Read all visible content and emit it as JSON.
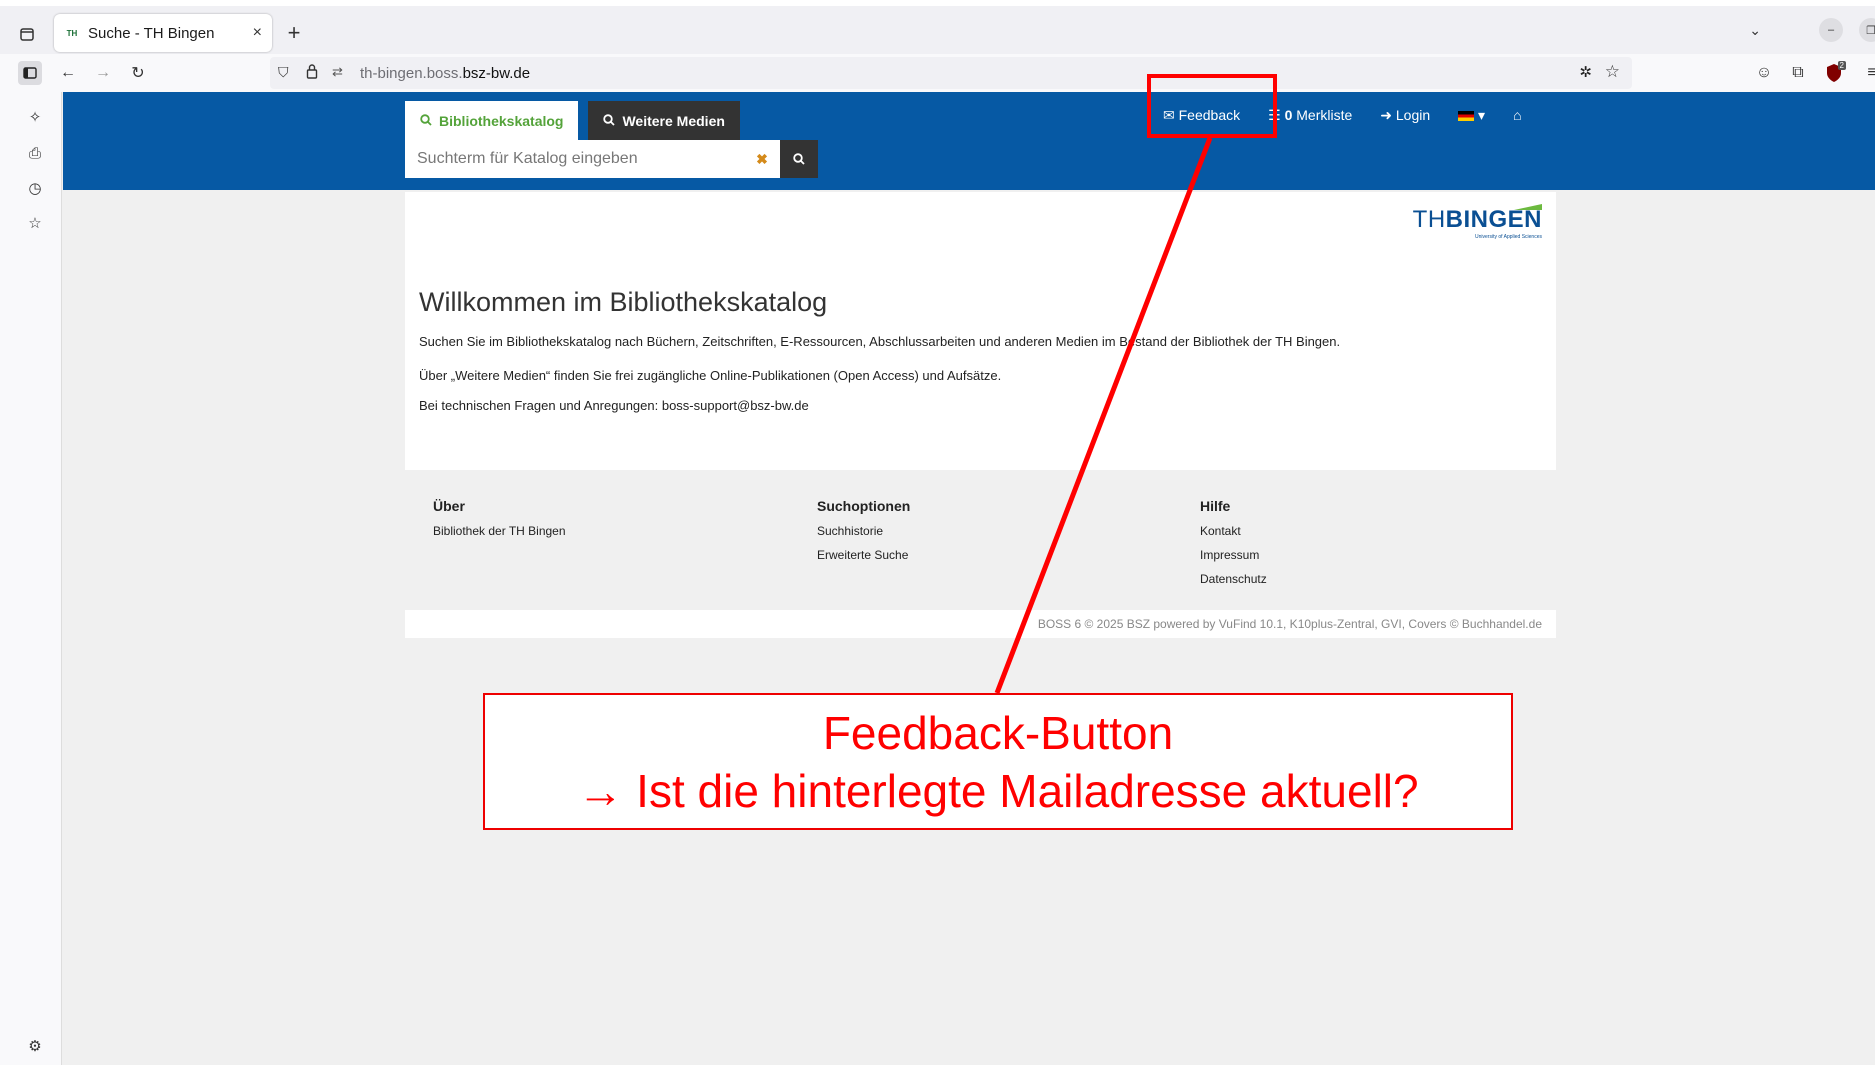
{
  "browser": {
    "tab": {
      "favicon": "TH",
      "title": "Suche - TH Bingen",
      "close": "×"
    },
    "new_tab": "+",
    "url_host_prefix": "th-bingen.boss.",
    "url_host_domain": "bsz-bw.de",
    "extension_badge": "2"
  },
  "header": {
    "tabs": [
      {
        "label": "Bibliothekskatalog",
        "icon": "search-icon"
      },
      {
        "label": "Weitere Medien",
        "icon": "search-icon"
      }
    ],
    "search_placeholder": "Suchterm für Katalog eingeben",
    "clear_glyph": "✖",
    "links": {
      "feedback": "Feedback",
      "merkliste_count": "0",
      "merkliste": "Merkliste",
      "login": "Login"
    }
  },
  "logo": {
    "th": "TH",
    "bingen": "BINGEN",
    "sub": "University of Applied Sciences"
  },
  "content": {
    "title": "Willkommen im Bibliothekskatalog",
    "p1": "Suchen Sie im Bibliothekskatalog nach Büchern, Zeitschriften, E-Ressourcen, Abschlussarbeiten und anderen Medien im Bestand der Bibliothek der TH Bingen.",
    "p2": "Über „Weitere Medien“ finden Sie frei zugängliche Online-Publikationen (Open Access) und Aufsätze.",
    "p3": "Bei technischen Fragen und Anregungen: boss-support@bsz-bw.de"
  },
  "footer": {
    "cols": [
      {
        "title": "Über",
        "links": [
          "Bibliothek der TH Bingen"
        ]
      },
      {
        "title": "Suchoptionen",
        "links": [
          "Suchhistorie",
          "Erweiterte Suche"
        ]
      },
      {
        "title": "Hilfe",
        "links": [
          "Kontakt",
          "Impressum",
          "Datenschutz"
        ]
      }
    ],
    "copyright": "BOSS 6 © 2025 BSZ powered by VuFind 10.1, K10plus-Zentral, GVI, Covers © Buchhandel.de"
  },
  "annotation": {
    "line1": "Feedback-Button",
    "line2": "→ Ist die hinterlegte Mailadresse aktuell?",
    "color": "#ff0000"
  },
  "colors": {
    "header_blue": "#0659a4",
    "active_tab_green": "#54a33a",
    "logo_green": "#6cba3f"
  }
}
